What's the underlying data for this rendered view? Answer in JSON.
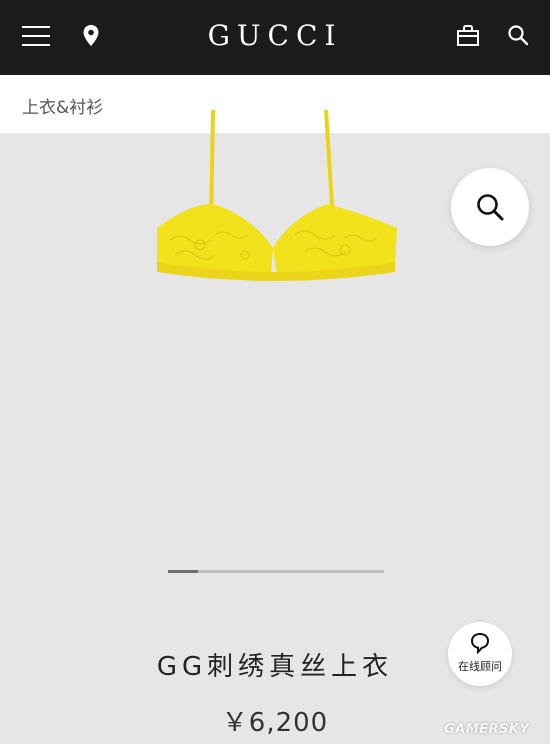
{
  "header": {
    "brand": "GUCCI",
    "icons": [
      "menu-icon",
      "location-icon",
      "shopping-bag-icon",
      "search-icon"
    ]
  },
  "breadcrumb": {
    "label": "上衣&衬衫"
  },
  "product": {
    "image_icon": "yellow-lace-bra",
    "zoom_icon": "magnifier-icon",
    "title": "GG刺绣真丝上衣",
    "price": "￥6,200"
  },
  "carousel": {
    "progress": 0.14
  },
  "chat": {
    "label": "在线顾问",
    "icon": "chat-bubble-icon"
  },
  "watermark": {
    "text": "GAMERSKY"
  },
  "colors": {
    "header_bg": "#1b1b1b",
    "page_bg": "#e6e6e6",
    "product_yellow": "#f2e21c"
  }
}
